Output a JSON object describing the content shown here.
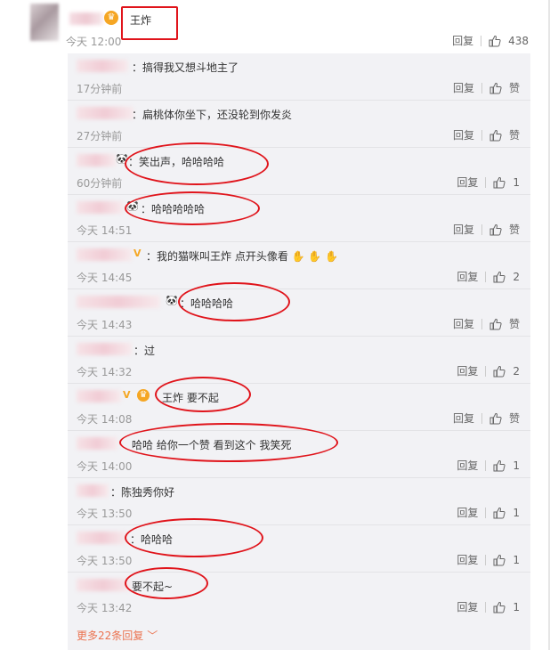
{
  "top_comment": {
    "content": "王炸",
    "time": "今天 12:00",
    "reply_label": "回复",
    "like_count": "438"
  },
  "replies": [
    {
      "text": "：搞得我又想斗地主了",
      "time": "17分钟前",
      "reply_label": "回复",
      "like": "赞"
    },
    {
      "text": "：扁桃体你坐下，还没轮到你发炎",
      "time": "27分钟前",
      "reply_label": "回复",
      "like": "赞"
    },
    {
      "text": "：笑出声，哈哈哈哈",
      "time": "60分钟前",
      "reply_label": "回复",
      "like": "1"
    },
    {
      "text": "：哈哈哈哈哈",
      "time": "今天 14:51",
      "reply_label": "回复",
      "like": "赞"
    },
    {
      "text": "：我的猫咪叫王炸 点开头像看",
      "time": "今天 14:45",
      "reply_label": "回复",
      "like": "2"
    },
    {
      "text": "：哈哈哈哈",
      "time": "今天 14:43",
      "reply_label": "回复",
      "like": "赞"
    },
    {
      "text": "：过",
      "time": "今天 14:32",
      "reply_label": "回复",
      "like": "2"
    },
    {
      "text": "王炸 要不起",
      "time": "今天 14:08",
      "reply_label": "回复",
      "like": "赞"
    },
    {
      "text": "哈哈 给你一个赞 看到这个 我笑死",
      "time": "今天 14:00",
      "reply_label": "回复",
      "like": "1"
    },
    {
      "text": "：陈独秀你好",
      "time": "今天 13:50",
      "reply_label": "回复",
      "like": "1"
    },
    {
      "text": "：哈哈哈",
      "time": "今天 13:50",
      "reply_label": "回复",
      "like": "1"
    },
    {
      "text": "要不起~",
      "time": "今天 13:42",
      "reply_label": "回复",
      "like": "1"
    }
  ],
  "more_replies": "更多22条回复",
  "colors": {
    "annotation": "#e0141b",
    "link": "#eb7350",
    "panel_bg": "#f2f2f5"
  },
  "icons": [
    "thumbs-up-icon",
    "panda-emoji-icon",
    "vip-badge-icon",
    "chevron-down-icon"
  ]
}
